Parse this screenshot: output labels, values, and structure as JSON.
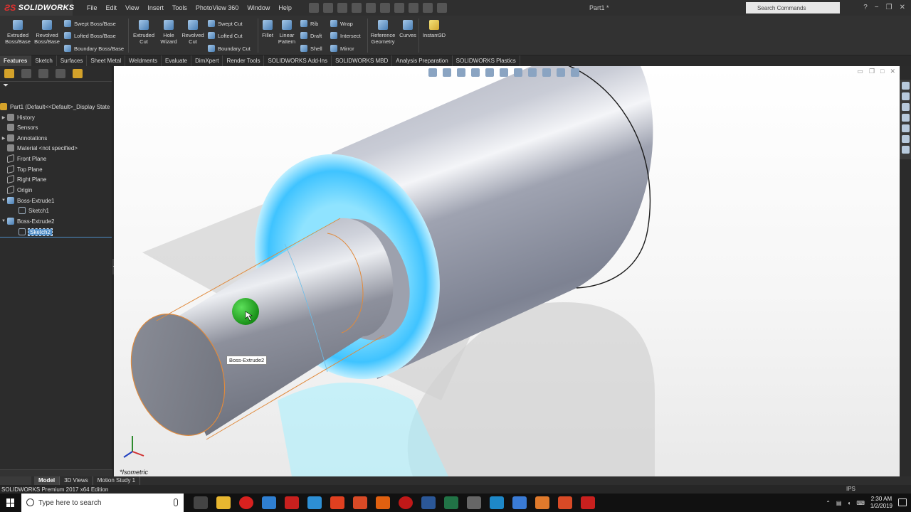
{
  "app": {
    "logo_text": "SOLIDWORKS",
    "doc_title": "Part1 *",
    "menu": [
      "File",
      "Edit",
      "View",
      "Insert",
      "Tools",
      "PhotoView 360",
      "Window",
      "Help"
    ],
    "search_placeholder": "Search Commands",
    "window_buttons": [
      "?",
      "−",
      "❐",
      "✕"
    ]
  },
  "ribbon": {
    "extruded_boss": "Extruded Boss/Base",
    "revolved_boss": "Revolved Boss/Base",
    "swept_boss": "Swept Boss/Base",
    "lofted_boss": "Lofted Boss/Base",
    "boundary_boss": "Boundary Boss/Base",
    "extruded_cut": "Extruded Cut",
    "hole_wizard": "Hole Wizard",
    "revolved_cut": "Revolved Cut",
    "swept_cut": "Swept Cut",
    "lofted_cut": "Lofted Cut",
    "boundary_cut": "Boundary Cut",
    "fillet": "Fillet",
    "linear_pattern": "Linear Pattern",
    "rib": "Rib",
    "draft": "Draft",
    "shell": "Shell",
    "wrap": "Wrap",
    "intersect": "Intersect",
    "mirror": "Mirror",
    "reference_geometry": "Reference Geometry",
    "curves": "Curves",
    "instant3d": "Instant3D"
  },
  "tabs": [
    "Features",
    "Sketch",
    "Surfaces",
    "Sheet Metal",
    "Weldments",
    "Evaluate",
    "DimXpert",
    "Render Tools",
    "SOLIDWORKS Add-Ins",
    "SOLIDWORKS MBD",
    "Analysis Preparation",
    "SOLIDWORKS Plastics"
  ],
  "tree": {
    "root": "Part1  (Default<<Default>_Display State",
    "history": "History",
    "sensors": "Sensors",
    "annotations": "Annotations",
    "material": "Material <not specified>",
    "front_plane": "Front Plane",
    "top_plane": "Top Plane",
    "right_plane": "Right Plane",
    "origin": "Origin",
    "boss_extrude1": "Boss-Extrude1",
    "sketch1": "Sketch1",
    "boss_extrude2": "Boss-Extrude2",
    "sketch2": "Sketch2"
  },
  "viewport": {
    "tooltip": "Boss-Extrude2",
    "view_label": "*Isometric",
    "colors": {
      "ring_highlight": "#3fc3ff",
      "cylinder_body": "#9aa0ad",
      "selection_edge": "#e08a3c",
      "cursor_ball": "#22a81e"
    }
  },
  "bottom_tabs": [
    "Model",
    "3D Views",
    "Motion Study 1"
  ],
  "status": {
    "text": "SOLIDWORKS Premium 2017 x64 Edition",
    "units": "IPS"
  },
  "taskbar": {
    "search_placeholder": "Type here to search",
    "time": "2:30 AM",
    "date": "1/2/2019"
  }
}
